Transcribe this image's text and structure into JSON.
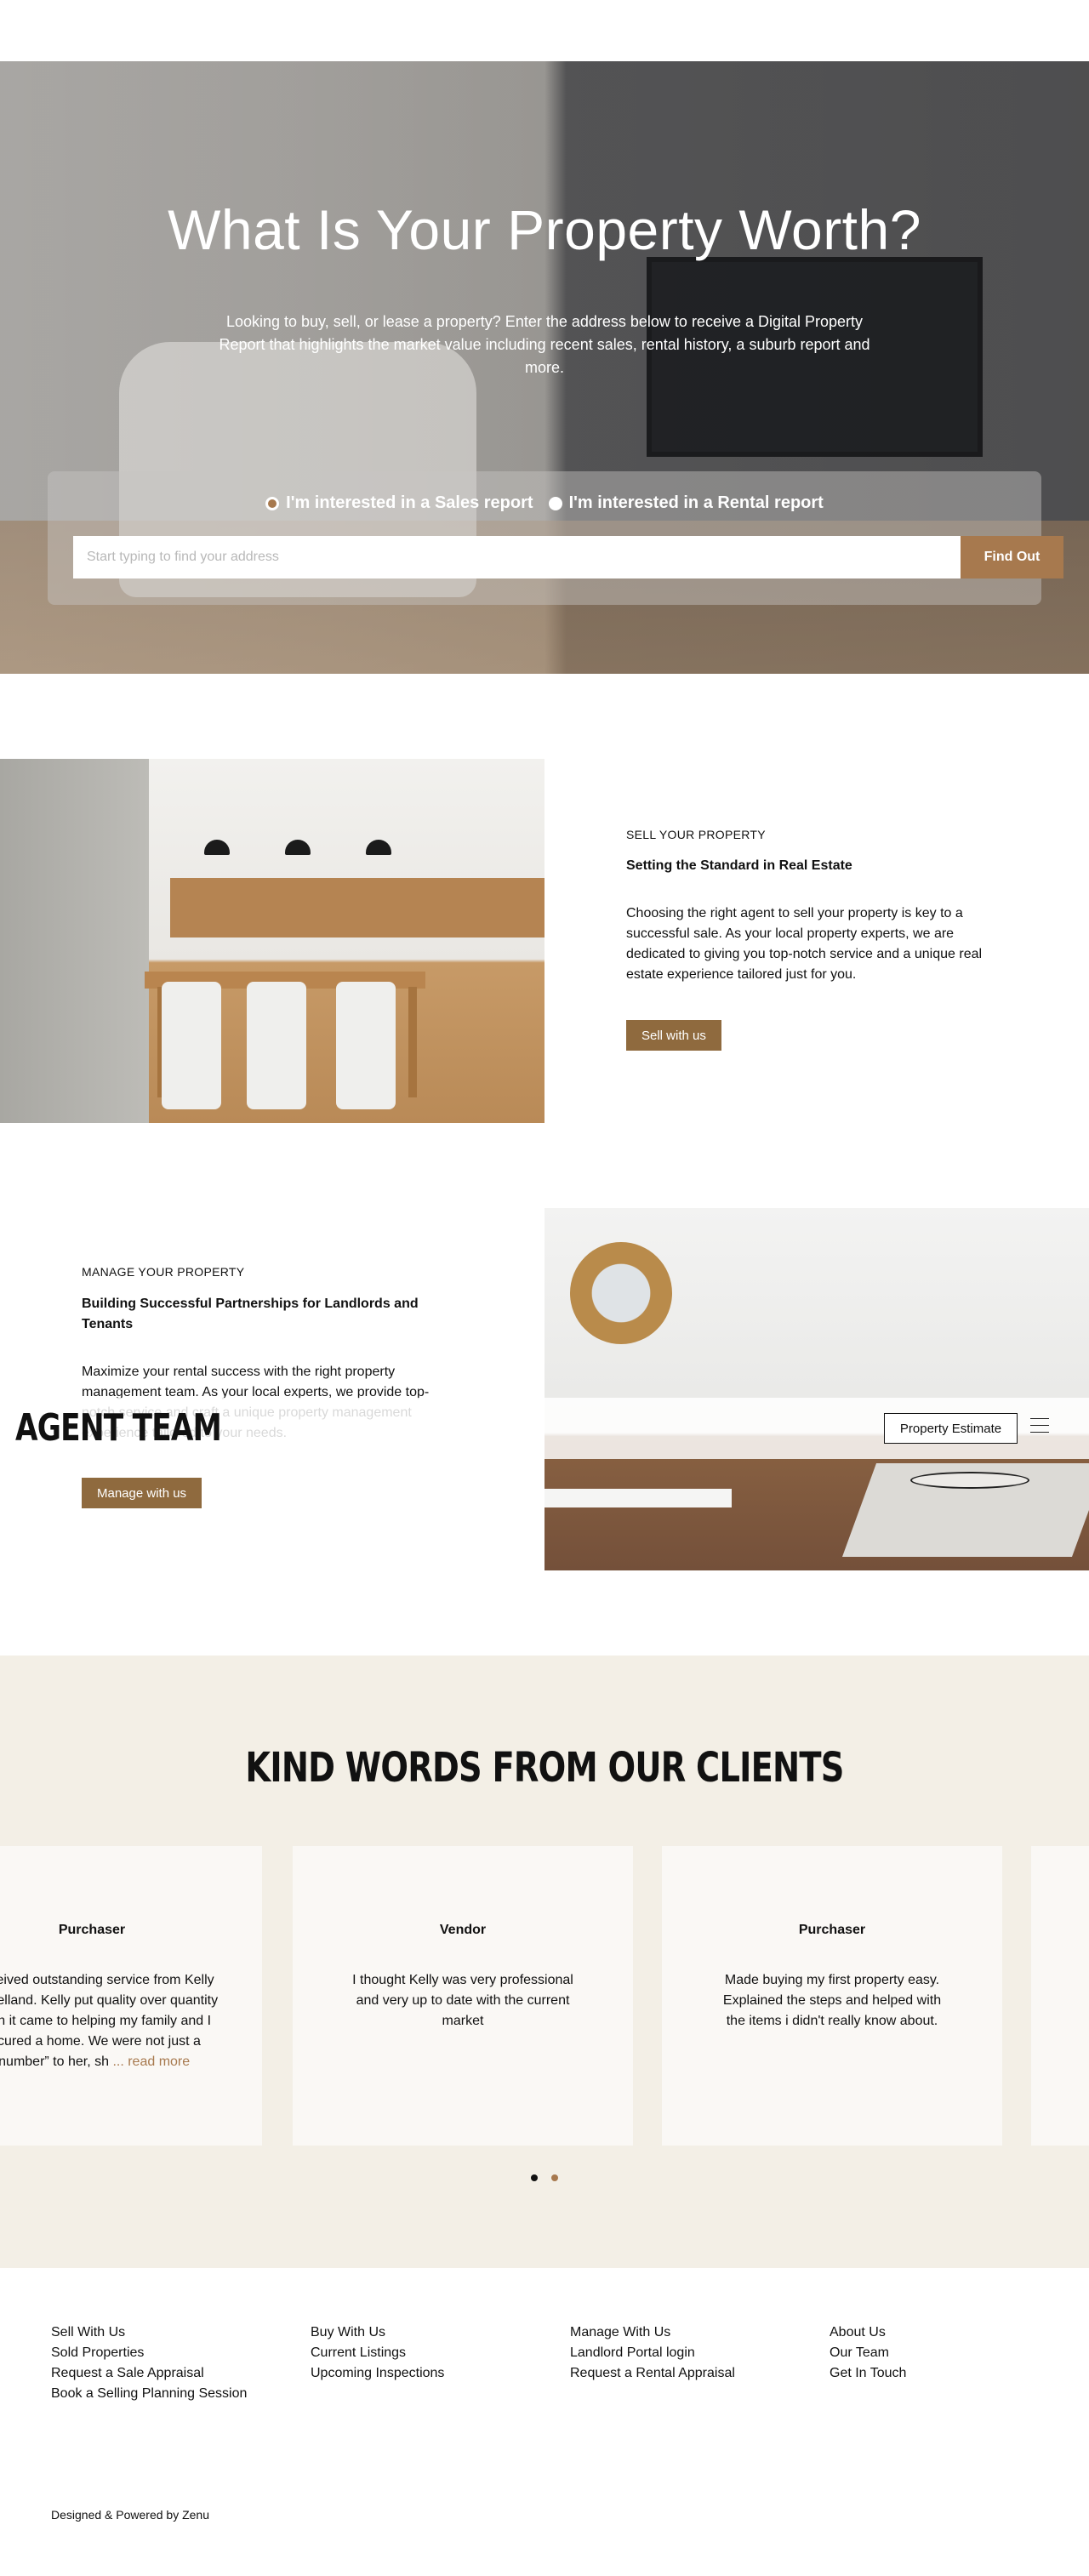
{
  "hero": {
    "title": "What Is Your Property Worth?",
    "subtitle": "Looking to buy, sell, or lease a property? Enter the address below to receive a Digital Property Report that highlights the market value including recent sales, rental history, a suburb report and more.",
    "radio_sales": "I'm interested in a Sales report",
    "radio_rental": "I'm interested in a Rental report",
    "selected_report": "sales",
    "search_placeholder": "Start typing to find your address",
    "search_value": "",
    "find_button": "Find Out"
  },
  "sell": {
    "eyebrow": "SELL YOUR PROPERTY",
    "title": "Setting the Standard in Real Estate",
    "body": "Choosing the right agent to sell your property is key to a successful sale. As your local property experts, we are dedicated to giving you top-notch service and a unique real estate experience tailored just for you.",
    "button": "Sell with us"
  },
  "manage": {
    "eyebrow": "MANAGE YOUR PROPERTY",
    "title": "Building Successful Partnerships for Landlords and Tenants",
    "body": "Maximize your rental success with the right property management team. As your local experts, we provide top-notch service and craft a unique property management experience tailored to your needs.",
    "button": "Manage with us"
  },
  "header": {
    "logo": "AGENT TEAM",
    "estimate_button": "Property Estimate",
    "menu_icon": "hamburger-icon"
  },
  "testimonials": {
    "title": "KIND WORDS FROM OUR CLIENTS",
    "cards": [
      {
        "role": "Purchaser",
        "text": "I received outstanding service from Kelly McClelland.  Kelly put quality over quantity when it came to helping my family and I secured a home.   We were not just a “number” to her, sh",
        "more": " ... read more"
      },
      {
        "role": "Vendor",
        "text": "I thought Kelly was very professional and very up to date with the current market",
        "more": ""
      },
      {
        "role": "Purchaser",
        "text": "Made buying my first property easy. Explained the steps and helped with the items i didn't really know about.",
        "more": ""
      }
    ],
    "active_dot": 1
  },
  "footer": {
    "columns": [
      [
        "Sell With Us",
        "Sold Properties",
        "Request a Sale Appraisal",
        "Book a Selling Planning Session"
      ],
      [
        "Buy With Us",
        "Current Listings",
        "Upcoming Inspections"
      ],
      [
        "Manage With Us",
        "Landlord Portal login",
        "Request a Rental Appraisal"
      ],
      [
        "About Us",
        "Our Team",
        "Get In Touch"
      ]
    ],
    "credit": "Designed & Powered by Zenu"
  },
  "colors": {
    "accent": "#a7794e",
    "button_brown": "#8f6a3e",
    "testimonial_bg": "#f3efe6"
  }
}
